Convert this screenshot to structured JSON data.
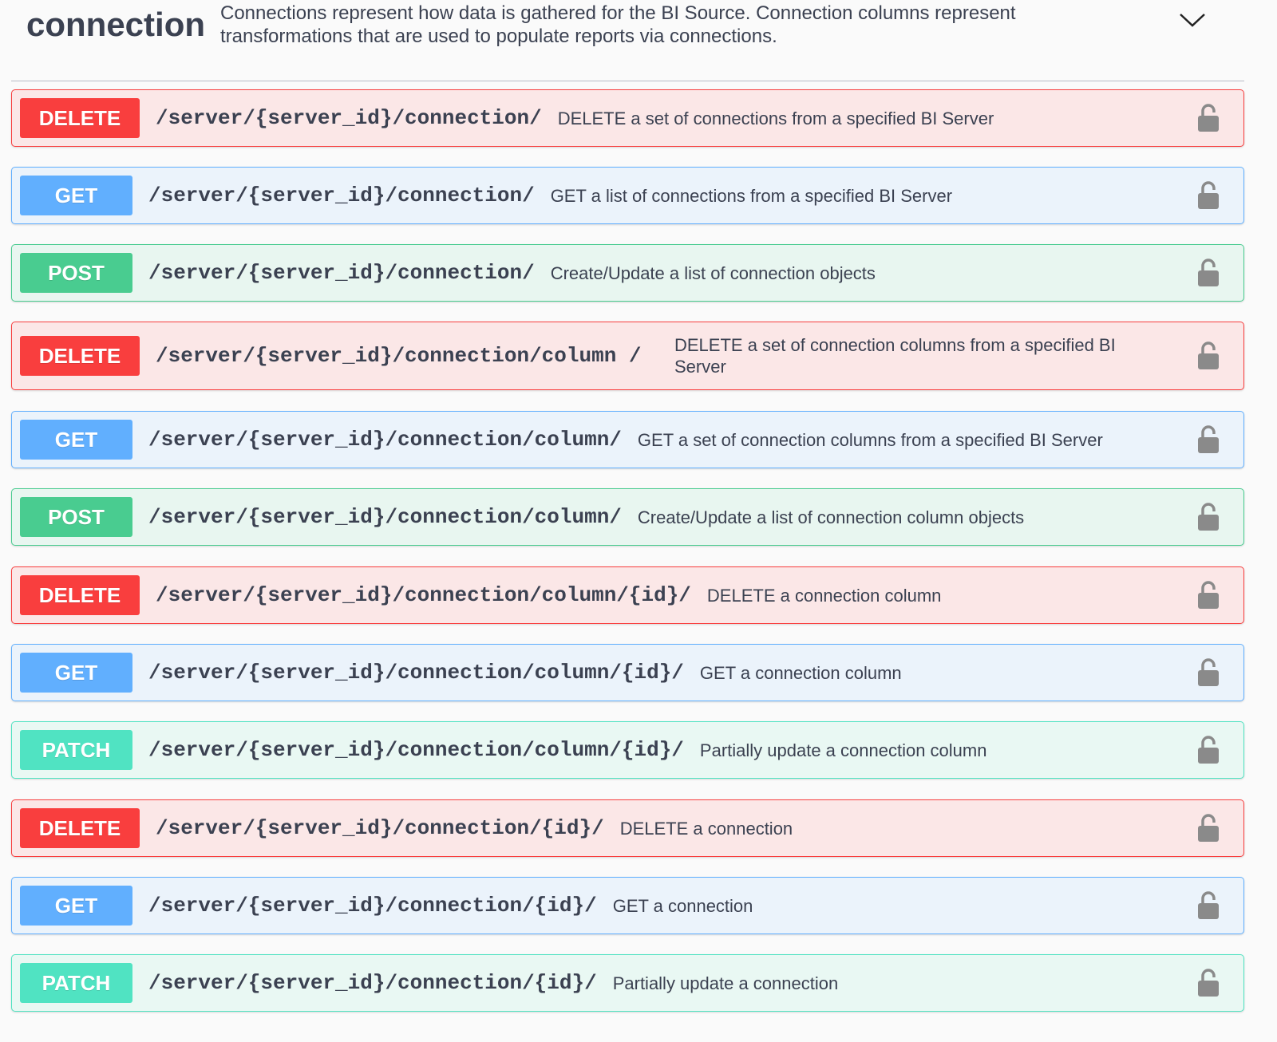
{
  "header": {
    "title": "connection",
    "description": "Connections represent how data is gathered for the BI Source. Connection columns represent transformations that are used to populate reports via connections.",
    "toggle_icon": "chevron-down-icon"
  },
  "colors": {
    "delete": "#f93e3e",
    "get": "#61affe",
    "post": "#49cc90",
    "patch": "#50e3c2",
    "lock": "#8a8a8a"
  },
  "operations": [
    {
      "method": "DELETE",
      "path": "/server/{server_id}/connection/",
      "summary": "DELETE a set of connections from a specified BI Server",
      "icon": "lock-icon"
    },
    {
      "method": "GET",
      "path": "/server/{server_id}/connection/",
      "summary": "GET a list of connections from a specified BI Server",
      "icon": "lock-icon"
    },
    {
      "method": "POST",
      "path": "/server/{server_id}/connection/",
      "summary": "Create/Update a list of connection objects",
      "icon": "lock-icon"
    },
    {
      "method": "DELETE",
      "path": "/server/{server_id}/connection/column /",
      "summary": "DELETE a set of connection columns from a specified BI Server",
      "icon": "lock-icon"
    },
    {
      "method": "GET",
      "path": "/server/{server_id}/connection/column/",
      "summary": "GET a set of connection columns from a specified BI Server",
      "icon": "lock-icon"
    },
    {
      "method": "POST",
      "path": "/server/{server_id}/connection/column/",
      "summary": "Create/Update a list of connection column objects",
      "icon": "lock-icon"
    },
    {
      "method": "DELETE",
      "path": "/server/{server_id}/connection/column/{id}/",
      "summary": "DELETE a connection column",
      "icon": "lock-icon"
    },
    {
      "method": "GET",
      "path": "/server/{server_id}/connection/column/{id}/",
      "summary": "GET a connection column",
      "icon": "lock-icon"
    },
    {
      "method": "PATCH",
      "path": "/server/{server_id}/connection/column/{id}/",
      "summary": "Partially update a connection column",
      "icon": "lock-icon"
    },
    {
      "method": "DELETE",
      "path": "/server/{server_id}/connection/{id}/",
      "summary": "DELETE a connection",
      "icon": "lock-icon"
    },
    {
      "method": "GET",
      "path": "/server/{server_id}/connection/{id}/",
      "summary": "GET a connection",
      "icon": "lock-icon"
    },
    {
      "method": "PATCH",
      "path": "/server/{server_id}/connection/{id}/",
      "summary": "Partially update a connection",
      "icon": "lock-icon"
    }
  ]
}
